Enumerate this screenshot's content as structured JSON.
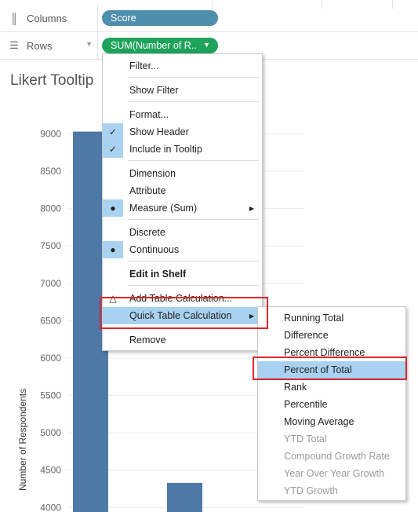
{
  "shelves": {
    "columns": {
      "label": "Columns",
      "pill": "Score",
      "icon": "columns-icon"
    },
    "rows": {
      "label": "Rows",
      "pill": "SUM(Number of R..",
      "icon": "rows-icon"
    }
  },
  "sheet_title": "Likert Tooltip",
  "colors": {
    "bar": "#4e79a7",
    "pill_blue": "#4d8fac",
    "pill_green": "#1fa35b",
    "highlight": "#a9d2f0",
    "callout": "#e0262b"
  },
  "context_menu": {
    "items": [
      {
        "label": "Filter..."
      },
      {
        "label": "Show Filter"
      },
      {
        "label": "Format..."
      },
      {
        "label": "Show Header",
        "checked": true
      },
      {
        "label": "Include in Tooltip",
        "checked": true
      },
      {
        "label": "Dimension"
      },
      {
        "label": "Attribute"
      },
      {
        "label": "Measure (Sum)",
        "selected": true,
        "submenu": true
      },
      {
        "label": "Discrete"
      },
      {
        "label": "Continuous",
        "selected": true
      },
      {
        "label": "Edit in Shelf",
        "bold": true
      },
      {
        "label": "Add Table Calculation..."
      },
      {
        "label": "Quick Table Calculation",
        "submenu": true,
        "highlighted": true
      },
      {
        "label": "Remove"
      }
    ]
  },
  "quick_table_calc_menu": {
    "items": [
      {
        "label": "Running Total",
        "enabled": true
      },
      {
        "label": "Difference",
        "enabled": true
      },
      {
        "label": "Percent Difference",
        "enabled": true
      },
      {
        "label": "Percent of Total",
        "enabled": true,
        "highlighted": true
      },
      {
        "label": "Rank",
        "enabled": true
      },
      {
        "label": "Percentile",
        "enabled": true
      },
      {
        "label": "Moving Average",
        "enabled": true
      },
      {
        "label": "YTD Total",
        "enabled": false
      },
      {
        "label": "Compound Growth Rate",
        "enabled": false
      },
      {
        "label": "Year Over Year Growth",
        "enabled": false
      },
      {
        "label": "YTD Growth",
        "enabled": false
      }
    ]
  },
  "chart_data": {
    "type": "bar",
    "ylabel": "Number of Respondents",
    "yticks": [
      4000,
      4500,
      5000,
      5500,
      6000,
      6500,
      7000,
      7500,
      8000,
      8500,
      9000
    ],
    "ylim": [
      3940,
      9320
    ],
    "series": [
      {
        "values": [
          9030,
          4330
        ]
      }
    ]
  }
}
